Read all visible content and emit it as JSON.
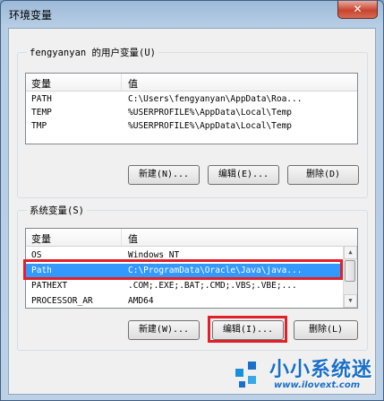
{
  "window": {
    "title": "环境变量",
    "close_glyph": "✕"
  },
  "user_group": {
    "title": "fengyanyan 的用户变量(U)",
    "columns": {
      "name": "变量",
      "value": "值"
    },
    "rows": [
      {
        "name": "PATH",
        "value": "C:\\Users\\fengyanyan\\AppData\\Roa..."
      },
      {
        "name": "TEMP",
        "value": "%USERPROFILE%\\AppData\\Local\\Temp"
      },
      {
        "name": "TMP",
        "value": "%USERPROFILE%\\AppData\\Local\\Temp"
      }
    ],
    "buttons": {
      "new": "新建(N)...",
      "edit": "编辑(E)...",
      "delete": "删除(D)"
    }
  },
  "system_group": {
    "title": "系统变量(S)",
    "columns": {
      "name": "变量",
      "value": "值"
    },
    "rows": [
      {
        "name": "OS",
        "value": "Windows_NT"
      },
      {
        "name": "Path",
        "value": "C:\\ProgramData\\Oracle\\Java\\java..."
      },
      {
        "name": "PATHEXT",
        "value": ".COM;.EXE;.BAT;.CMD;.VBS;.VBE;..."
      },
      {
        "name": "PROCESSOR_AR",
        "value": "AMD64"
      }
    ],
    "selected_index": 1,
    "buttons": {
      "new": "新建(W)...",
      "edit": "编辑(I)...",
      "delete": "删除(L)"
    }
  },
  "watermark": {
    "text": "小小系统迷",
    "url": "www.ilovext.com"
  },
  "colors": {
    "selection": "#3399ff",
    "highlight_box": "#e0202a",
    "watermark": "#1a6fc9"
  }
}
